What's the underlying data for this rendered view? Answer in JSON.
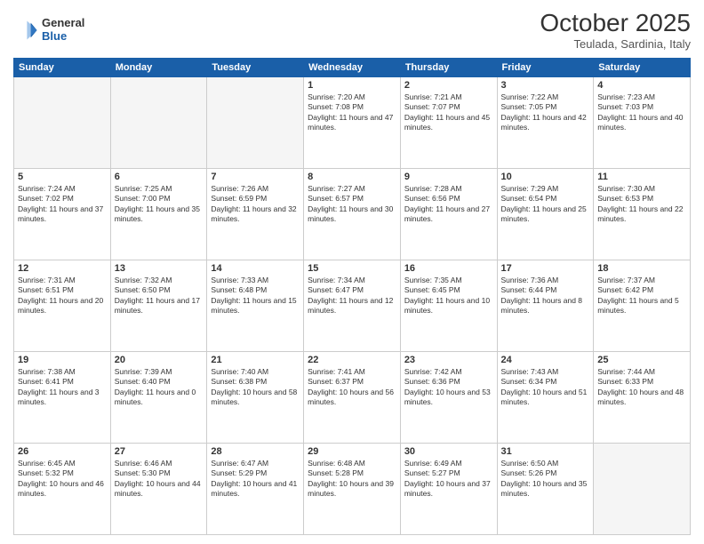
{
  "header": {
    "logo_general": "General",
    "logo_blue": "Blue",
    "month_title": "October 2025",
    "subtitle": "Teulada, Sardinia, Italy"
  },
  "days_of_week": [
    "Sunday",
    "Monday",
    "Tuesday",
    "Wednesday",
    "Thursday",
    "Friday",
    "Saturday"
  ],
  "weeks": [
    [
      {
        "day": "",
        "empty": true
      },
      {
        "day": "",
        "empty": true
      },
      {
        "day": "",
        "empty": true
      },
      {
        "day": "1",
        "sunrise": "7:20 AM",
        "sunset": "7:08 PM",
        "daylight": "11 hours and 47 minutes."
      },
      {
        "day": "2",
        "sunrise": "7:21 AM",
        "sunset": "7:07 PM",
        "daylight": "11 hours and 45 minutes."
      },
      {
        "day": "3",
        "sunrise": "7:22 AM",
        "sunset": "7:05 PM",
        "daylight": "11 hours and 42 minutes."
      },
      {
        "day": "4",
        "sunrise": "7:23 AM",
        "sunset": "7:03 PM",
        "daylight": "11 hours and 40 minutes."
      }
    ],
    [
      {
        "day": "5",
        "sunrise": "7:24 AM",
        "sunset": "7:02 PM",
        "daylight": "11 hours and 37 minutes."
      },
      {
        "day": "6",
        "sunrise": "7:25 AM",
        "sunset": "7:00 PM",
        "daylight": "11 hours and 35 minutes."
      },
      {
        "day": "7",
        "sunrise": "7:26 AM",
        "sunset": "6:59 PM",
        "daylight": "11 hours and 32 minutes."
      },
      {
        "day": "8",
        "sunrise": "7:27 AM",
        "sunset": "6:57 PM",
        "daylight": "11 hours and 30 minutes."
      },
      {
        "day": "9",
        "sunrise": "7:28 AM",
        "sunset": "6:56 PM",
        "daylight": "11 hours and 27 minutes."
      },
      {
        "day": "10",
        "sunrise": "7:29 AM",
        "sunset": "6:54 PM",
        "daylight": "11 hours and 25 minutes."
      },
      {
        "day": "11",
        "sunrise": "7:30 AM",
        "sunset": "6:53 PM",
        "daylight": "11 hours and 22 minutes."
      }
    ],
    [
      {
        "day": "12",
        "sunrise": "7:31 AM",
        "sunset": "6:51 PM",
        "daylight": "11 hours and 20 minutes."
      },
      {
        "day": "13",
        "sunrise": "7:32 AM",
        "sunset": "6:50 PM",
        "daylight": "11 hours and 17 minutes."
      },
      {
        "day": "14",
        "sunrise": "7:33 AM",
        "sunset": "6:48 PM",
        "daylight": "11 hours and 15 minutes."
      },
      {
        "day": "15",
        "sunrise": "7:34 AM",
        "sunset": "6:47 PM",
        "daylight": "11 hours and 12 minutes."
      },
      {
        "day": "16",
        "sunrise": "7:35 AM",
        "sunset": "6:45 PM",
        "daylight": "11 hours and 10 minutes."
      },
      {
        "day": "17",
        "sunrise": "7:36 AM",
        "sunset": "6:44 PM",
        "daylight": "11 hours and 8 minutes."
      },
      {
        "day": "18",
        "sunrise": "7:37 AM",
        "sunset": "6:42 PM",
        "daylight": "11 hours and 5 minutes."
      }
    ],
    [
      {
        "day": "19",
        "sunrise": "7:38 AM",
        "sunset": "6:41 PM",
        "daylight": "11 hours and 3 minutes."
      },
      {
        "day": "20",
        "sunrise": "7:39 AM",
        "sunset": "6:40 PM",
        "daylight": "11 hours and 0 minutes."
      },
      {
        "day": "21",
        "sunrise": "7:40 AM",
        "sunset": "6:38 PM",
        "daylight": "10 hours and 58 minutes."
      },
      {
        "day": "22",
        "sunrise": "7:41 AM",
        "sunset": "6:37 PM",
        "daylight": "10 hours and 56 minutes."
      },
      {
        "day": "23",
        "sunrise": "7:42 AM",
        "sunset": "6:36 PM",
        "daylight": "10 hours and 53 minutes."
      },
      {
        "day": "24",
        "sunrise": "7:43 AM",
        "sunset": "6:34 PM",
        "daylight": "10 hours and 51 minutes."
      },
      {
        "day": "25",
        "sunrise": "7:44 AM",
        "sunset": "6:33 PM",
        "daylight": "10 hours and 48 minutes."
      }
    ],
    [
      {
        "day": "26",
        "sunrise": "6:45 AM",
        "sunset": "5:32 PM",
        "daylight": "10 hours and 46 minutes."
      },
      {
        "day": "27",
        "sunrise": "6:46 AM",
        "sunset": "5:30 PM",
        "daylight": "10 hours and 44 minutes."
      },
      {
        "day": "28",
        "sunrise": "6:47 AM",
        "sunset": "5:29 PM",
        "daylight": "10 hours and 41 minutes."
      },
      {
        "day": "29",
        "sunrise": "6:48 AM",
        "sunset": "5:28 PM",
        "daylight": "10 hours and 39 minutes."
      },
      {
        "day": "30",
        "sunrise": "6:49 AM",
        "sunset": "5:27 PM",
        "daylight": "10 hours and 37 minutes."
      },
      {
        "day": "31",
        "sunrise": "6:50 AM",
        "sunset": "5:26 PM",
        "daylight": "10 hours and 35 minutes."
      },
      {
        "day": "",
        "empty": true
      }
    ]
  ]
}
